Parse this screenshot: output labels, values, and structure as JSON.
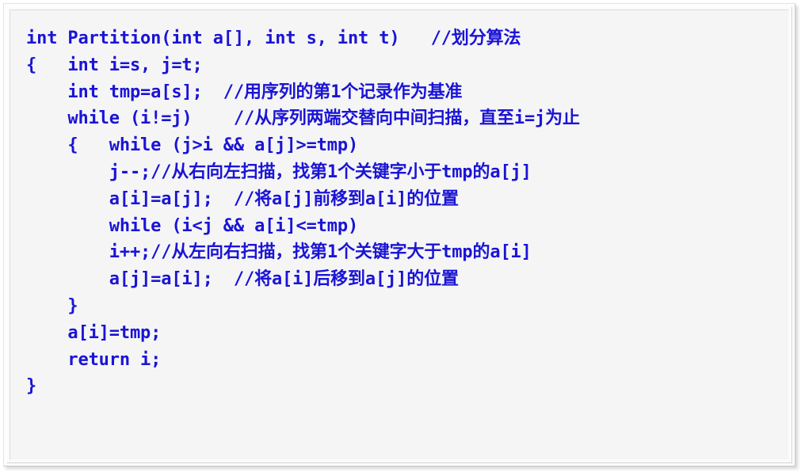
{
  "document": {
    "kind": "code-listing-slide",
    "language": "C",
    "function_name": "Partition",
    "background_color": "#f5f5f5",
    "text_color": "#1a14d6",
    "frame_color": "#ffffff"
  },
  "code": {
    "lines": [
      "int Partition(int a[], int s, int t)   //划分算法",
      "{   int i=s, j=t;",
      "    int tmp=a[s];  //用序列的第1个记录作为基准",
      "    while (i!=j)    //从序列两端交替向中间扫描，直至i=j为止",
      "    {   while (j>i && a[j]>=tmp)",
      "        j--;//从右向左扫描，找第1个关键字小于tmp的a[j]",
      "        a[i]=a[j];  //将a[j]前移到a[i]的位置",
      "        while (i<j && a[i]<=tmp)",
      "        i++;//从左向右扫描，找第1个关键字大于tmp的a[i]",
      "        a[j]=a[i];  //将a[i]后移到a[j]的位置",
      "    }",
      "    a[i]=tmp;",
      "    return i;",
      "}"
    ]
  }
}
